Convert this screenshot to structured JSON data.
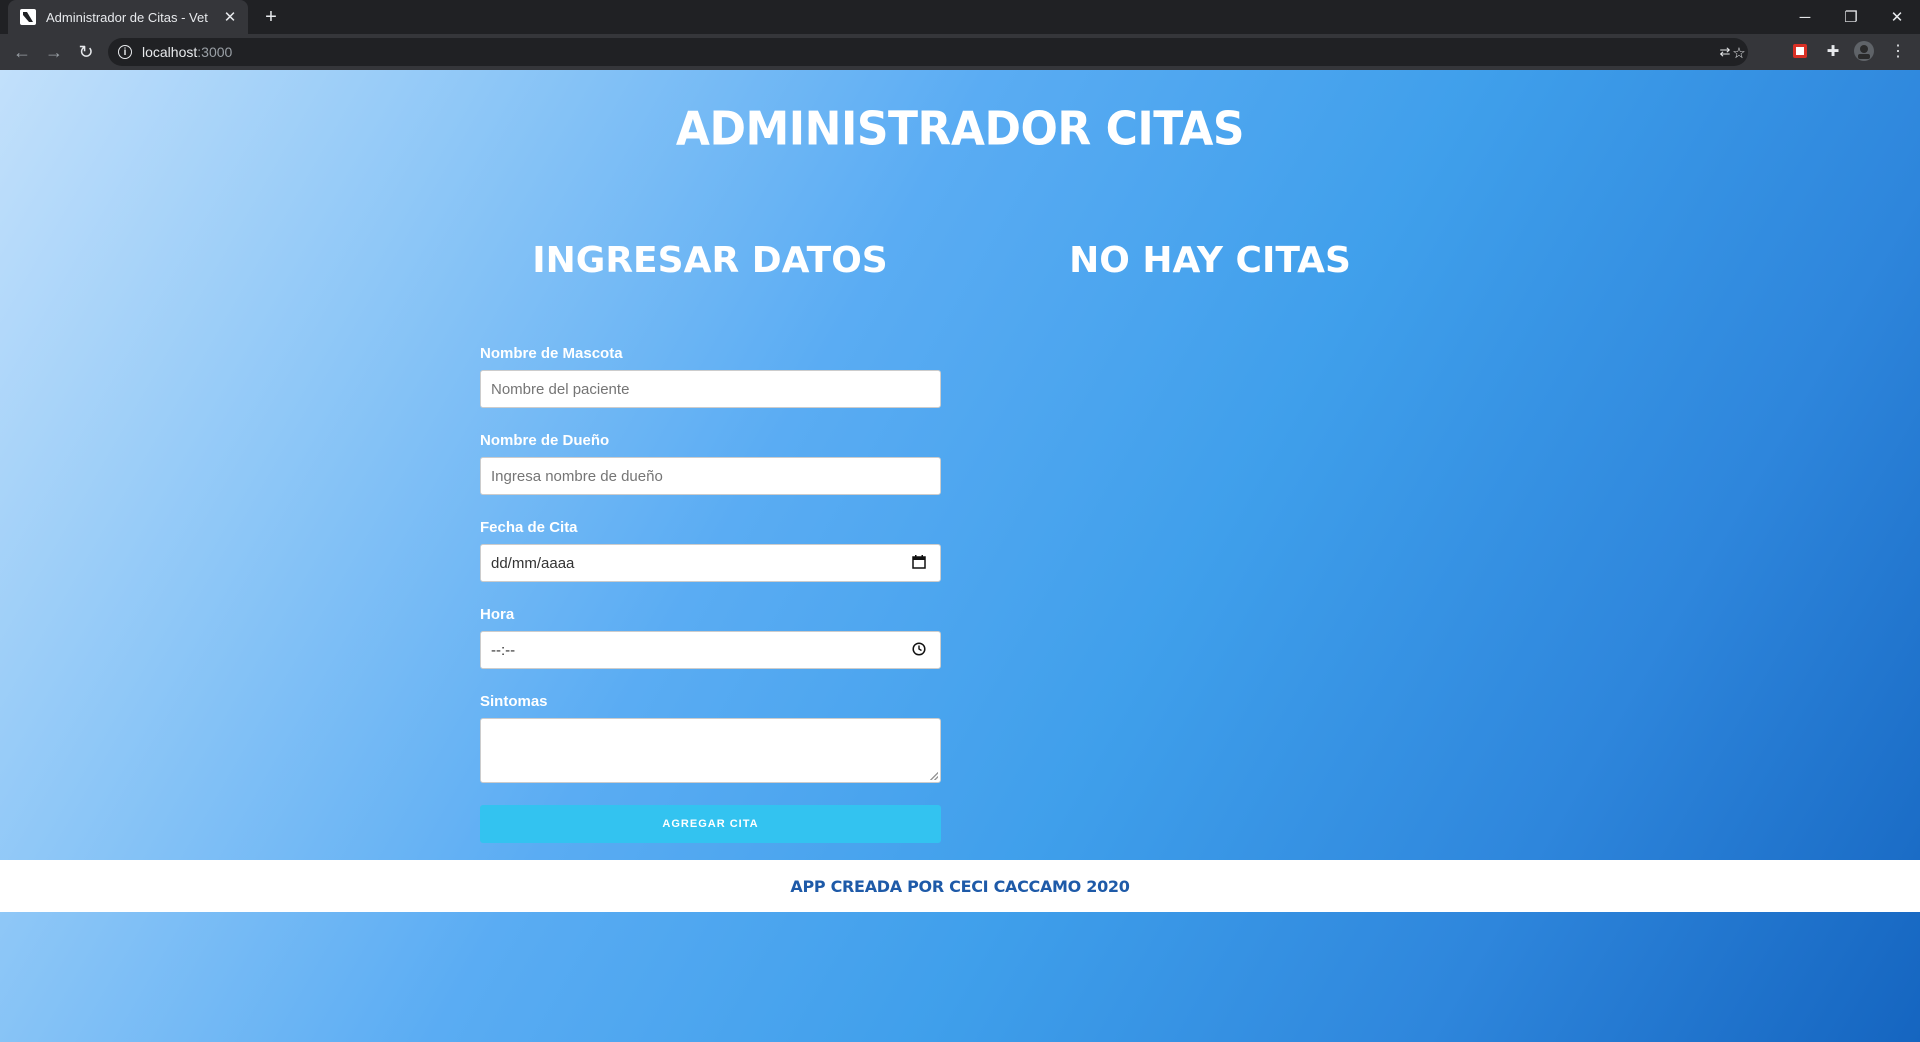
{
  "browser": {
    "tab_title": "Administrador de Citas - Vet",
    "tab_close": "✕",
    "new_tab": "+",
    "url_host": "localhost",
    "url_port": ":3000",
    "window_controls": {
      "minimize": "─",
      "restore": "❐",
      "close": "✕"
    }
  },
  "app": {
    "title": "Administrador Citas",
    "form_title": "Ingresar Datos",
    "list_title": "No hay citas",
    "form": {
      "pet_label": "Nombre de Mascota",
      "pet_placeholder": "Nombre del paciente",
      "owner_label": "Nombre de Dueño",
      "owner_placeholder": "Ingresa nombre de dueño",
      "date_label": "Fecha de Cita",
      "date_value": "dd/mm/aaaa",
      "time_label": "Hora",
      "time_value": "--:--",
      "symptoms_label": "Sintomas",
      "symptoms_value": "",
      "submit_label": "Agregar Cita"
    },
    "footer": "App creada por Ceci Caccamo 2020"
  },
  "colors": {
    "button": "#33c3f0",
    "footer_text": "#1e5aa8",
    "gradient_start": "#c2e0fb",
    "gradient_end": "#1565c0"
  }
}
